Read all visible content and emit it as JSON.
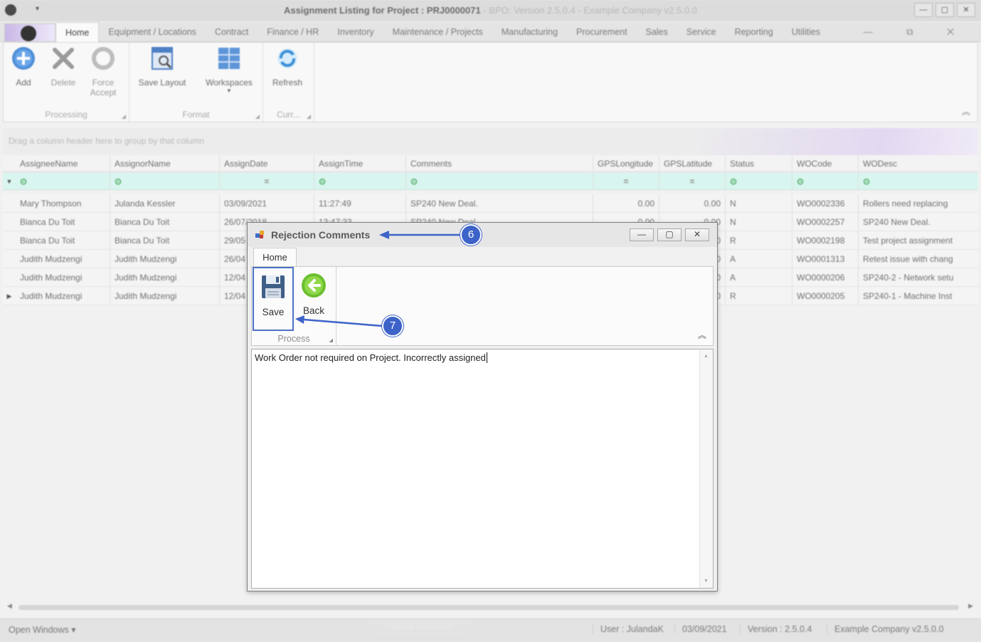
{
  "window": {
    "title": "Assignment Listing for Project : PRJ0000071",
    "version_text": " - BPO: Version 2.5.0.4 - Example Company v2.5.0.0",
    "quick_access": "▾",
    "buttons": [
      "—",
      "▢",
      "✕"
    ]
  },
  "tabs": [
    {
      "label": "Home",
      "active": true
    },
    {
      "label": "Equipment / Locations"
    },
    {
      "label": "Contract"
    },
    {
      "label": "Finance / HR"
    },
    {
      "label": "Inventory"
    },
    {
      "label": "Maintenance / Projects"
    },
    {
      "label": "Manufacturing"
    },
    {
      "label": "Procurement"
    },
    {
      "label": "Sales"
    },
    {
      "label": "Service"
    },
    {
      "label": "Reporting"
    },
    {
      "label": "Utilities"
    }
  ],
  "tab_controls": "— ⧉ ✕",
  "ribbon": {
    "processing": {
      "label": "Processing",
      "add": "Add",
      "delete": "Delete",
      "force_accept": "Force Accept"
    },
    "format": {
      "label": "Format",
      "save_layout": "Save Layout",
      "workspaces": "Workspaces"
    },
    "curr": {
      "label": "Curr...",
      "refresh": "Refresh"
    },
    "collapse_icon": "chevron-up-icon"
  },
  "group_panel_text": "Drag a column header here to group by that column",
  "grid": {
    "columns": [
      "AssigneeName",
      "AssignorName",
      "AssignDate",
      "AssignTime",
      "Comments",
      "GPSLongitude",
      "GPSLatitude",
      "Status",
      "WOCode",
      "WODesc"
    ],
    "filter_row": [
      "⊙",
      "⊙",
      "=",
      "⊙",
      "⊙",
      "=",
      "=",
      "⊙",
      "⊙",
      "⊙"
    ],
    "rows": [
      [
        "Mary Thompson",
        "Julanda Kessler",
        "03/09/2021",
        "11:27:49",
        "SP240 New Deal.",
        "0.00",
        "0.00",
        "N",
        "WO0002336",
        "Rollers need replacing"
      ],
      [
        "Bianca Du Toit",
        "Bianca Du Toit",
        "26/07/2018",
        "13:47:33",
        "SP240 New Deal.",
        "0.00",
        "0.00",
        "N",
        "WO0002257",
        "SP240 New Deal."
      ],
      [
        "Bianca Du Toit",
        "Bianca Du Toit",
        "29/05",
        "",
        "",
        "",
        "0.00",
        "R",
        "WO0002198",
        "Test project assignment"
      ],
      [
        "Judith Mudzengi",
        "Judith Mudzengi",
        "26/04",
        "",
        "",
        "",
        "0.00",
        "A",
        "WO0001313",
        "Retest issue with chang"
      ],
      [
        "Judith Mudzengi",
        "Judith Mudzengi",
        "12/04",
        "",
        "",
        "",
        "0.00",
        "A",
        "WO0000206",
        "SP240-2 - Network setu"
      ],
      [
        "Judith Mudzengi",
        "Judith Mudzengi",
        "12/04",
        "",
        "",
        "",
        "0.00",
        "R",
        "WO0000205",
        "SP240-1 - Machine Inst"
      ]
    ]
  },
  "statusbar": {
    "open_windows": "Open Windows ▾",
    "capture": "Capture screenshot",
    "user": "User : JulandaK",
    "date": "03/09/2021",
    "version": "Version : 2.5.0.4",
    "company": "Example Company v2.5.0.0"
  },
  "dialog": {
    "title": "Rejection Comments",
    "tab": "Home",
    "save": "Save",
    "back": "Back",
    "group": "Process",
    "comment": "Work Order not required on Project.  Incorrectly assigned"
  },
  "callouts": {
    "title_marker": "6",
    "save_marker": "7"
  },
  "colors": {
    "callout": "#3d63c9",
    "filter_row": "#d9f5ef",
    "highlight_border": "#4d72c8"
  }
}
